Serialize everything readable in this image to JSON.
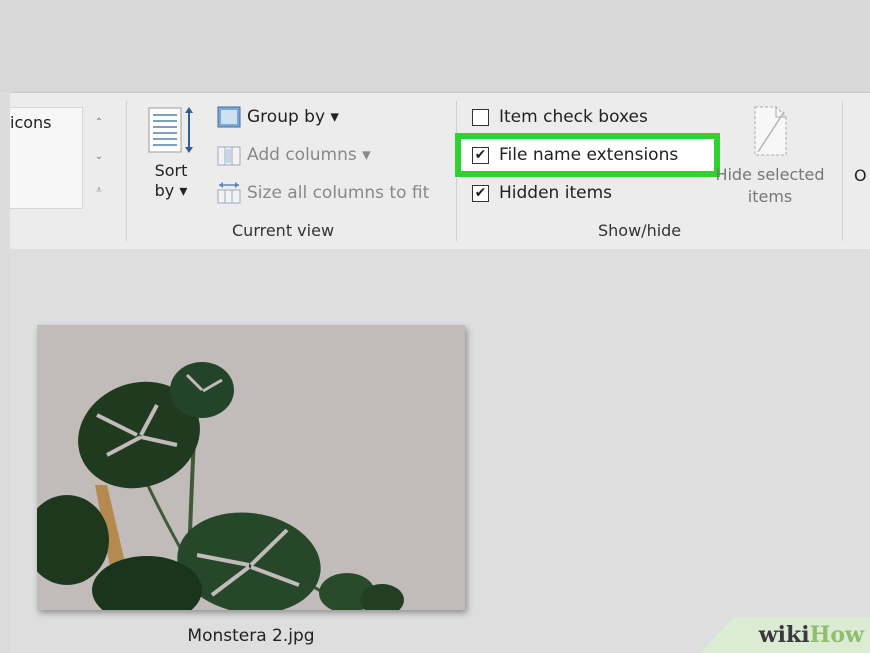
{
  "ribbon": {
    "layout": {
      "visible_text": "icons",
      "scroll_up": "⌃",
      "scroll_down": "⌄",
      "more": "⩡"
    },
    "current_view": {
      "sort_by_label_1": "Sort",
      "sort_by_label_2": "by ▾",
      "group_by": "Group by ▾",
      "add_columns": "Add columns ▾",
      "size_all_columns": "Size all columns to fit",
      "group_label": "Current view"
    },
    "show_hide": {
      "item_check_boxes": {
        "label": "Item check boxes",
        "checked": false
      },
      "file_name_extensions": {
        "label": "File name extensions",
        "checked": true,
        "highlighted": true
      },
      "hidden_items": {
        "label": "Hidden items",
        "checked": true
      },
      "hide_selected_line1": "Hide selected",
      "hide_selected_line2": "items",
      "group_label": "Show/hide"
    },
    "options_partial": "O"
  },
  "file": {
    "name": "Monstera 2.jpg"
  },
  "watermark": {
    "part1": "wiki",
    "part2": "How"
  },
  "colors": {
    "highlight": "#2fd22f",
    "ribbon_bg": "#ececec",
    "content_bg": "#dedede"
  },
  "checkmark": "✔"
}
